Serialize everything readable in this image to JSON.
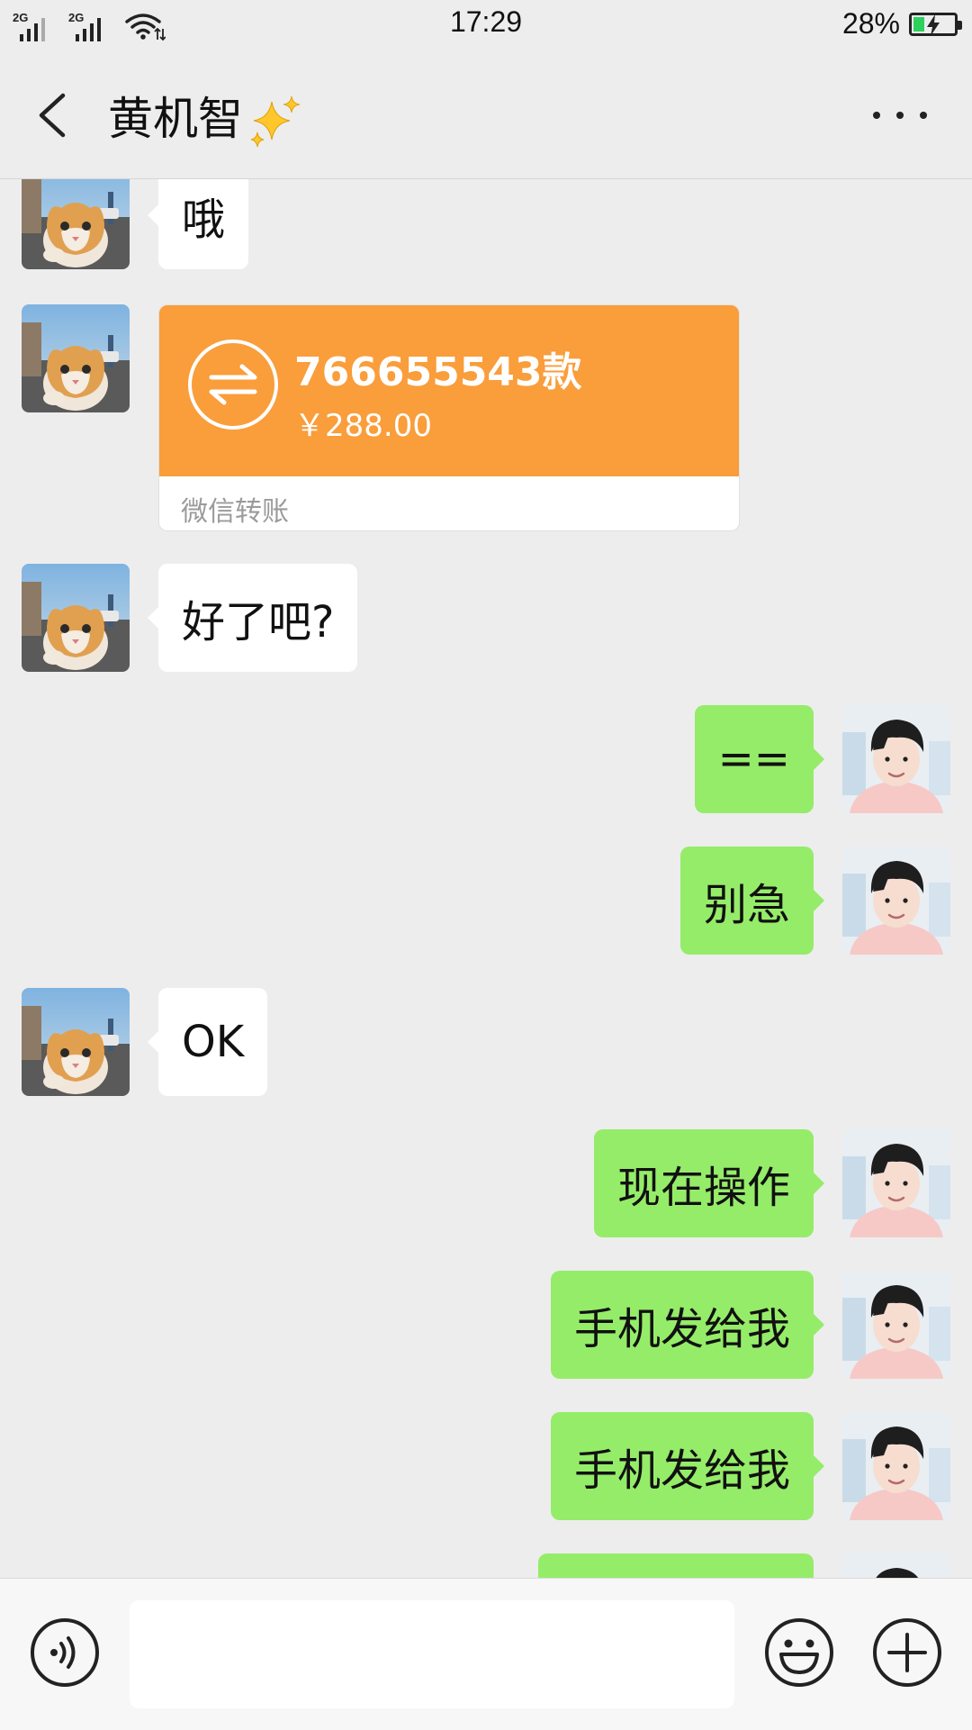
{
  "status_bar": {
    "sim1": "2G",
    "sim2": "2G",
    "time": "17:29",
    "battery_percent_text": "28%",
    "battery_level": 0.28,
    "charging": true,
    "colors": {
      "battery_fill": "#2bd25b"
    }
  },
  "header": {
    "title": "黄机智",
    "title_decoration": "sparkles-emoji",
    "back_icon": "chevron-left-icon",
    "more_icon": "more-dots-icon"
  },
  "chat": {
    "colors": {
      "background": "#ededed",
      "incoming_bubble": "#ffffff",
      "outgoing_bubble": "#95ec69",
      "transfer_card": "#fa9d3b"
    },
    "messages": [
      {
        "side": "left",
        "type": "text",
        "text": "哦",
        "avatar": "cat-avatar"
      },
      {
        "side": "left",
        "type": "transfer",
        "note": "766655543款",
        "amount": "￥288.00",
        "label": "微信转账",
        "avatar": "cat-avatar"
      },
      {
        "side": "left",
        "type": "text",
        "text": "好了吧?",
        "avatar": "cat-avatar"
      },
      {
        "side": "right",
        "type": "text",
        "text": "==",
        "avatar": "boy-avatar"
      },
      {
        "side": "right",
        "type": "text",
        "text": "别急",
        "avatar": "boy-avatar"
      },
      {
        "side": "left",
        "type": "text",
        "text": "OK",
        "avatar": "cat-avatar"
      },
      {
        "side": "right",
        "type": "text",
        "text": "现在操作",
        "avatar": "boy-avatar"
      },
      {
        "side": "right",
        "type": "text",
        "text": "手机发给我",
        "avatar": "boy-avatar"
      },
      {
        "side": "right",
        "type": "text",
        "text": "手机发给我",
        "avatar": "boy-avatar"
      },
      {
        "side": "right",
        "type": "text",
        "text": "",
        "avatar": "boy-avatar"
      }
    ]
  },
  "input_bar": {
    "voice_icon": "voice-icon",
    "input_value": "",
    "emoji_icon": "emoji-icon",
    "plus_icon": "plus-icon"
  }
}
